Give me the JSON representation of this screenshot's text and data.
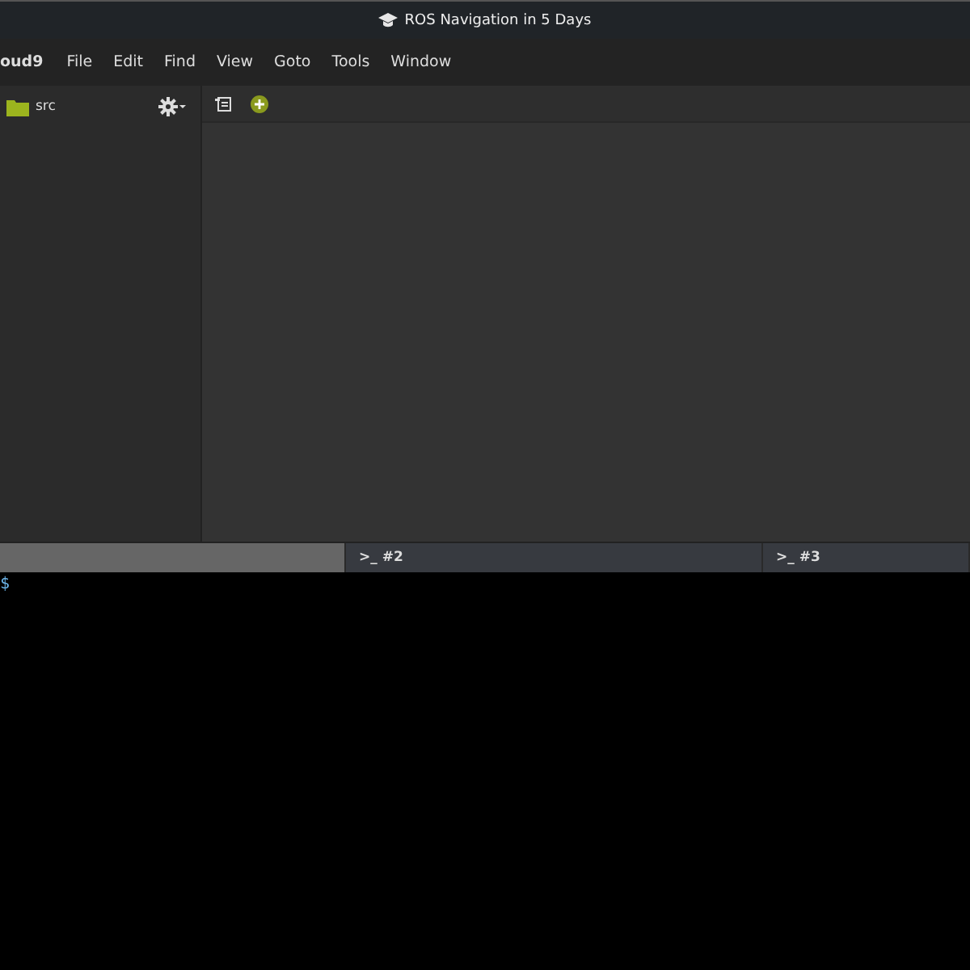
{
  "window": {
    "title": "ROS Navigation in 5 Days"
  },
  "menu": [
    "oud9",
    "File",
    "Edit",
    "Find",
    "View",
    "Goto",
    "Tools",
    "Window"
  ],
  "sidebar": {
    "items": [
      {
        "label": "src"
      }
    ]
  },
  "terminal": {
    "tabs": [
      {
        "selected": true
      },
      {
        "label": ">_ #2",
        "selected": false
      },
      {
        "label": ">_ #3",
        "selected": false
      }
    ],
    "prompt": "$"
  }
}
